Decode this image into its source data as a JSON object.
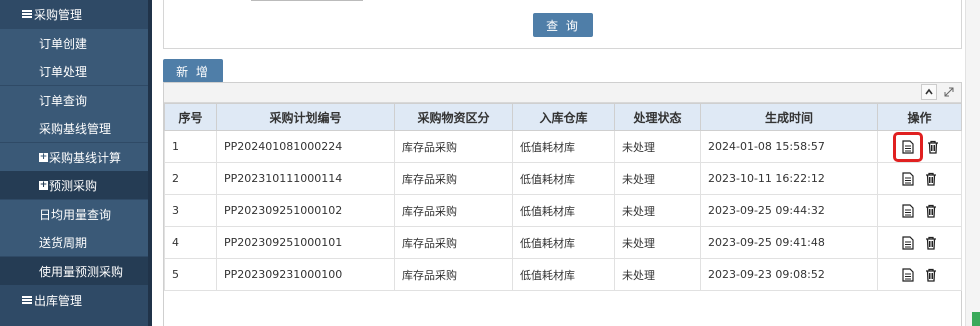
{
  "sidebar": {
    "group_purchase": "采购管理",
    "items": [
      {
        "label": "订单创建"
      },
      {
        "label": "订单处理"
      },
      {
        "label": "订单查询"
      },
      {
        "label": "采购基线管理"
      },
      {
        "label": "采购基线计算"
      },
      {
        "label": "预测采购"
      },
      {
        "label": "日均用量查询"
      },
      {
        "label": "送货周期"
      },
      {
        "label": "使用量预测采购"
      }
    ],
    "group_outbound": "出库管理"
  },
  "buttons": {
    "query": "查 询",
    "add": "新 增"
  },
  "table": {
    "headers": [
      "序号",
      "采购计划编号",
      "采购物资区分",
      "入库仓库",
      "处理状态",
      "生成时间",
      "操作"
    ],
    "rows": [
      {
        "no": "1",
        "plan_no": "PP202401081000224",
        "category": "库存品采购",
        "warehouse": "低值耗材库",
        "status": "未处理",
        "created": "2024-01-08 15:58:57"
      },
      {
        "no": "2",
        "plan_no": "PP202310111000114",
        "category": "库存品采购",
        "warehouse": "低值耗材库",
        "status": "未处理",
        "created": "2023-10-11 16:22:12"
      },
      {
        "no": "3",
        "plan_no": "PP202309251000102",
        "category": "库存品采购",
        "warehouse": "低值耗材库",
        "status": "未处理",
        "created": "2023-09-25 09:44:32"
      },
      {
        "no": "4",
        "plan_no": "PP202309251000101",
        "category": "库存品采购",
        "warehouse": "低值耗材库",
        "status": "未处理",
        "created": "2023-09-25 09:41:48"
      },
      {
        "no": "5",
        "plan_no": "PP202309231000100",
        "category": "库存品采购",
        "warehouse": "低值耗材库",
        "status": "未处理",
        "created": "2023-09-23 09:08:52"
      }
    ]
  },
  "icons": {
    "view": "document-icon",
    "delete": "trash-icon",
    "collapse": "chevron-up-icon",
    "expand": "expand-icon"
  },
  "colors": {
    "sidebar_bg": "#2f4a66",
    "sidebar_item": "#3a5977",
    "sidebar_active": "#253c54",
    "button": "#4f7ea8",
    "header_bg": "#dfe9f5",
    "highlight": "#e02020"
  }
}
